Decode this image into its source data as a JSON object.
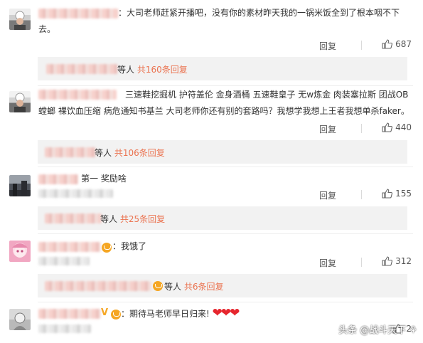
{
  "comments": [
    {
      "text_line1": "：大司老师赶紧开播吧，没有你的素材昨天我的一锅米饭全到了根本咽不下",
      "text_line2": "去。",
      "reply_label": "回复",
      "likes": "687",
      "sub_prefix": "等人",
      "sub_more": "共160条回复"
    },
    {
      "text_line1": "三速鞋挖掘机 护符盖伦 金身酒桶 五速鞋皇子 无w炼金 肉装塞拉斯 团战OB",
      "text_line2": "螳螂 裸饮血压缩 病危通知书基兰 大司老师你还有别的套路吗？我想学我想上王者我想单杀faker。",
      "reply_label": "回复",
      "likes": "440",
      "sub_prefix": "等人",
      "sub_more": "共106条回复"
    },
    {
      "text_line1": "第一 奖励啥",
      "reply_label": "回复",
      "likes": "155",
      "sub_prefix": "等人",
      "sub_more": "共25条回复"
    },
    {
      "text_line1": "：我饿了",
      "reply_label": "回复",
      "likes": "312",
      "sub_prefix": "等人",
      "sub_more": "共6条回复"
    },
    {
      "text_line1": "：期待马老师早日归来!",
      "hearts": "❤❤❤",
      "likes": "2"
    }
  ],
  "watermark": "头条 @战斗天下 ⚘"
}
